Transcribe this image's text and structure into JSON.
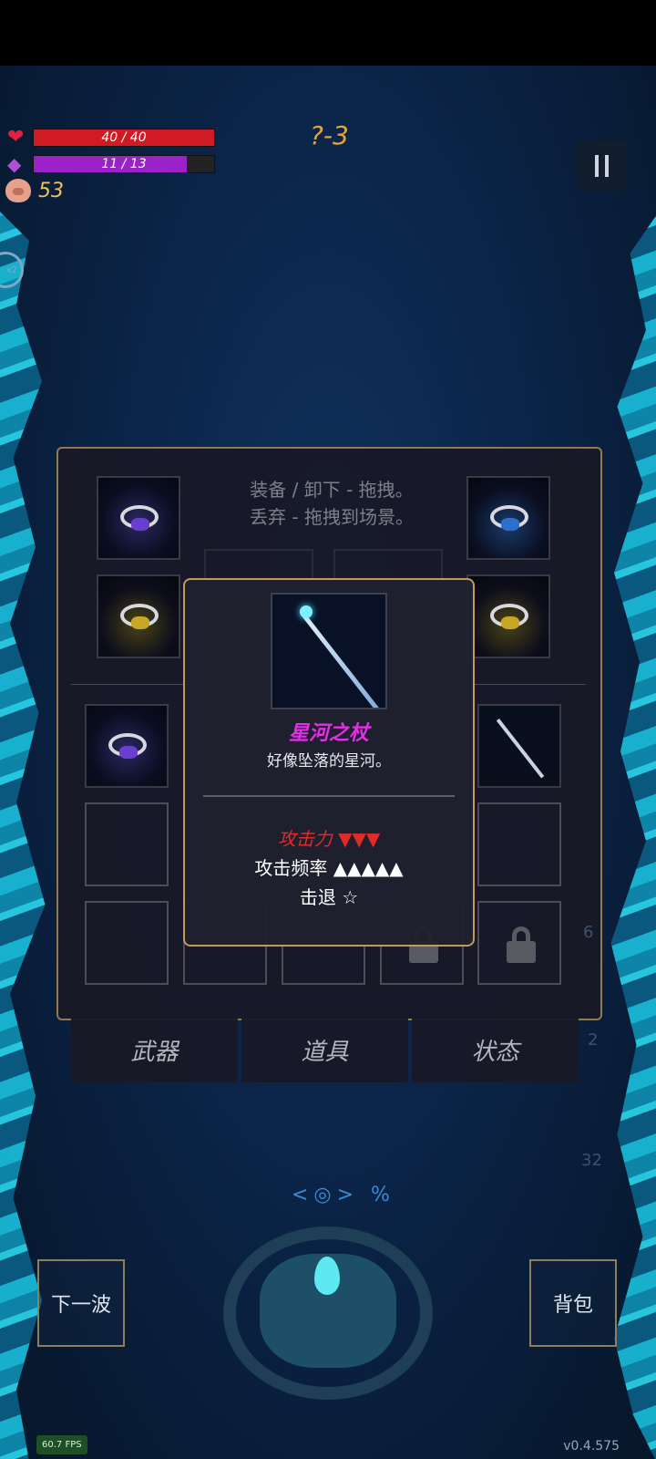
{
  "hud": {
    "hp_text": "40 / 40",
    "hp_fraction": 1.0,
    "mp_text": "11 / 13",
    "mp_fraction": 0.846,
    "coins": "53",
    "level": "?-3",
    "side_counter": "x2"
  },
  "colors": {
    "hp": "#d01a24",
    "mp": "#9a22c8",
    "rarity_name": "#e42ee8",
    "panel_border": "#8f7a55"
  },
  "inventory": {
    "hint_line1": "装备 / 卸下 - 拖拽。",
    "hint_line2": "丢弃 - 拖拽到场景。",
    "tabs": [
      "武器",
      "道具",
      "状态"
    ]
  },
  "tooltip": {
    "name": "星河之杖",
    "description": "好像坠落的星河。",
    "attack_label": "攻击力",
    "attack_value": "▼▼▼",
    "freq_label": "攻击频率",
    "freq_value": "▲▲▲▲▲",
    "knockback_label": "击退",
    "knockback_value": "☆"
  },
  "controls": {
    "next_wave": "下一波",
    "backpack": "背包",
    "runes": "<◎> %"
  },
  "side_numbers": [
    "6",
    "2",
    "32"
  ],
  "footer": {
    "fps": "60.7 FPS",
    "version": "v0.4.575"
  }
}
